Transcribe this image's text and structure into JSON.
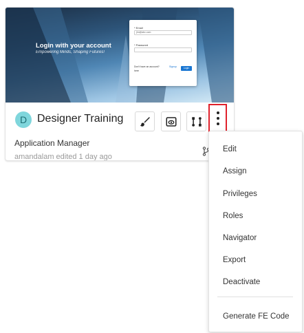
{
  "card": {
    "title": "Designer Training",
    "avatar_letter": "D",
    "subtitle": "Application Manager",
    "meta": "amandalam edited 1 day ago",
    "thumbnail": {
      "login_title": "Login with your account",
      "login_subtitle": "Empowering Minds, Shaping Futures!",
      "email_label": "* Email",
      "email_value": "jhn@abc.com",
      "password_label": "* Password",
      "signup_text": "Don't have an account?",
      "signup_link": "Signup",
      "signup_link2": "here",
      "login_button": "Login"
    },
    "actions": [
      "paintbrush-icon",
      "preview-icon",
      "workflow-icon",
      "more-vertical-icon"
    ]
  },
  "menu": {
    "items": [
      "Edit",
      "Assign",
      "Privileges",
      "Roles",
      "Navigator",
      "Export",
      "Deactivate"
    ],
    "footer_item": "Generate FE Code"
  },
  "colors": {
    "avatar_bg": "#7fd6dc",
    "highlight_border": "#e0202a"
  }
}
